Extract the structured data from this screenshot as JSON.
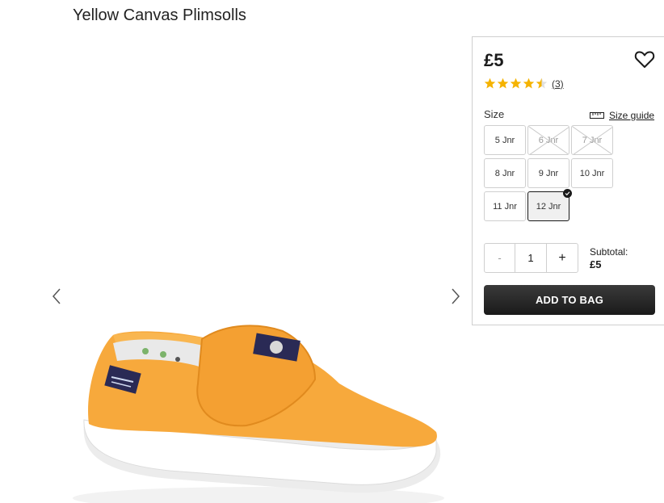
{
  "product": {
    "title": "Yellow Canvas Plimsolls",
    "price": "£5",
    "rating": 4.5,
    "rating_count": "(3)"
  },
  "gallery": {
    "prev_icon": "chevron-left-icon",
    "next_icon": "chevron-right-icon"
  },
  "size": {
    "label": "Size",
    "guide_label": "Size guide",
    "options": [
      {
        "label": "5 Jnr",
        "state": "available"
      },
      {
        "label": "6 Jnr",
        "state": "unavailable"
      },
      {
        "label": "7 Jnr",
        "state": "unavailable"
      },
      {
        "label": "8 Jnr",
        "state": "available"
      },
      {
        "label": "9 Jnr",
        "state": "available"
      },
      {
        "label": "10 Jnr",
        "state": "available"
      },
      {
        "label": "11 Jnr",
        "state": "available"
      },
      {
        "label": "12 Jnr",
        "state": "selected"
      }
    ]
  },
  "quantity": {
    "minus": "-",
    "value": "1",
    "plus": "+"
  },
  "subtotal": {
    "label": "Subtotal:",
    "amount": "£5"
  },
  "cta": {
    "add_to_bag": "ADD TO BAG"
  },
  "colors": {
    "star": "#f5b301",
    "button": "#1a1a1a",
    "shoe": "#f7a93c"
  }
}
